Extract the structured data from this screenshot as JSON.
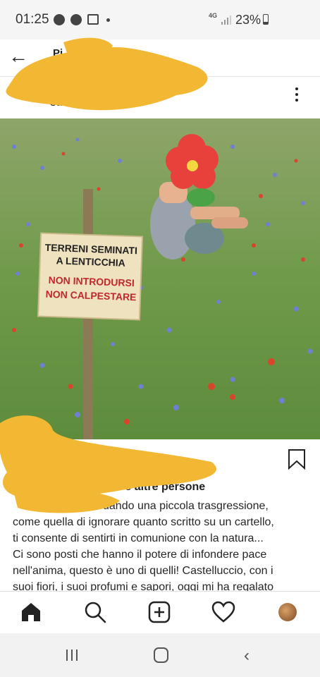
{
  "status_bar": {
    "time": "01:25",
    "network_label": "4G",
    "battery_percent": "23%",
    "icons": [
      "soccer-ball-icon",
      "facebook-icon",
      "image-icon",
      "dot-icon",
      "signal-icon",
      "battery-icon"
    ]
  },
  "header": {
    "title": "Pi",
    "subtitle": "ia"
  },
  "post": {
    "location": "Cast          cio          ia",
    "sign": {
      "line1": "TERRENI SEMINATI",
      "line2": "A LENTICCHIA",
      "line3": "NON INTRODURSI",
      "line4": "NON CALPESTARE"
    },
    "likes_prefix": "o e",
    "likes_suffix": "altre persone",
    "caption_lines": [
      "uando una piccola trasgressione,",
      "come quella di ignorare quanto scritto su un cartello,",
      "ti consente di sentirti in comunione con la natura...",
      "Ci sono posti che hanno il potere di infondere pace",
      "nell'anima, questo è uno di quelli! Castelluccio, con i",
      "suoi fiori, i suoi profumi e sapori, oggi mi ha regalato"
    ]
  },
  "colors": {
    "redaction": "#f2b834",
    "sign_red": "#c0282d",
    "meadow": "#6f9a4a"
  }
}
